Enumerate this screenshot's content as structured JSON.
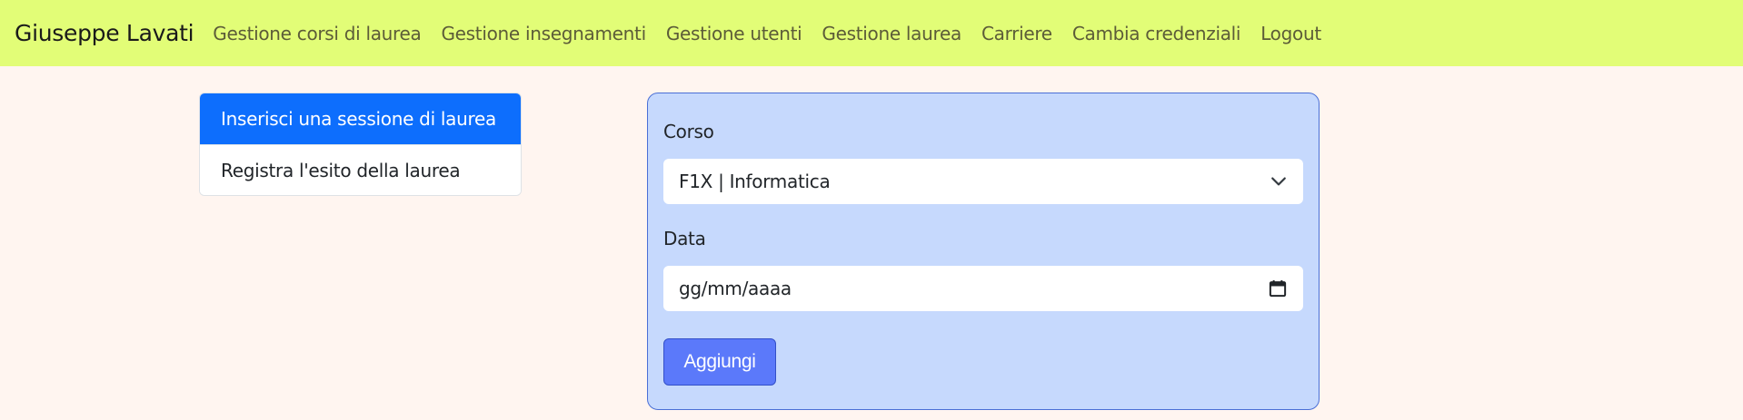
{
  "navbar": {
    "brand": "Giuseppe Lavati",
    "links": [
      {
        "label": "Gestione corsi di laurea"
      },
      {
        "label": "Gestione insegnamenti"
      },
      {
        "label": "Gestione utenti"
      },
      {
        "label": "Gestione laurea"
      },
      {
        "label": "Carriere"
      },
      {
        "label": "Cambia credenziali"
      },
      {
        "label": "Logout"
      }
    ],
    "background_color": "#e2fd77"
  },
  "sidebar": {
    "items": [
      {
        "label": "Inserisci una sessione di laurea",
        "active": true
      },
      {
        "label": "Registra l'esito della laurea",
        "active": false
      }
    ],
    "active_color": "#0d6efd"
  },
  "form": {
    "corso_label": "Corso",
    "corso_selected": "F1X | Informatica",
    "data_label": "Data",
    "data_placeholder": "gg/mm/aaaa",
    "submit_label": "Aggiungi",
    "card_color": "#c6d9fd",
    "button_color": "#5b79fa"
  },
  "icons": {
    "select": "chevron-down-icon",
    "date": "calendar-icon"
  },
  "page_background": "#fff5f0"
}
